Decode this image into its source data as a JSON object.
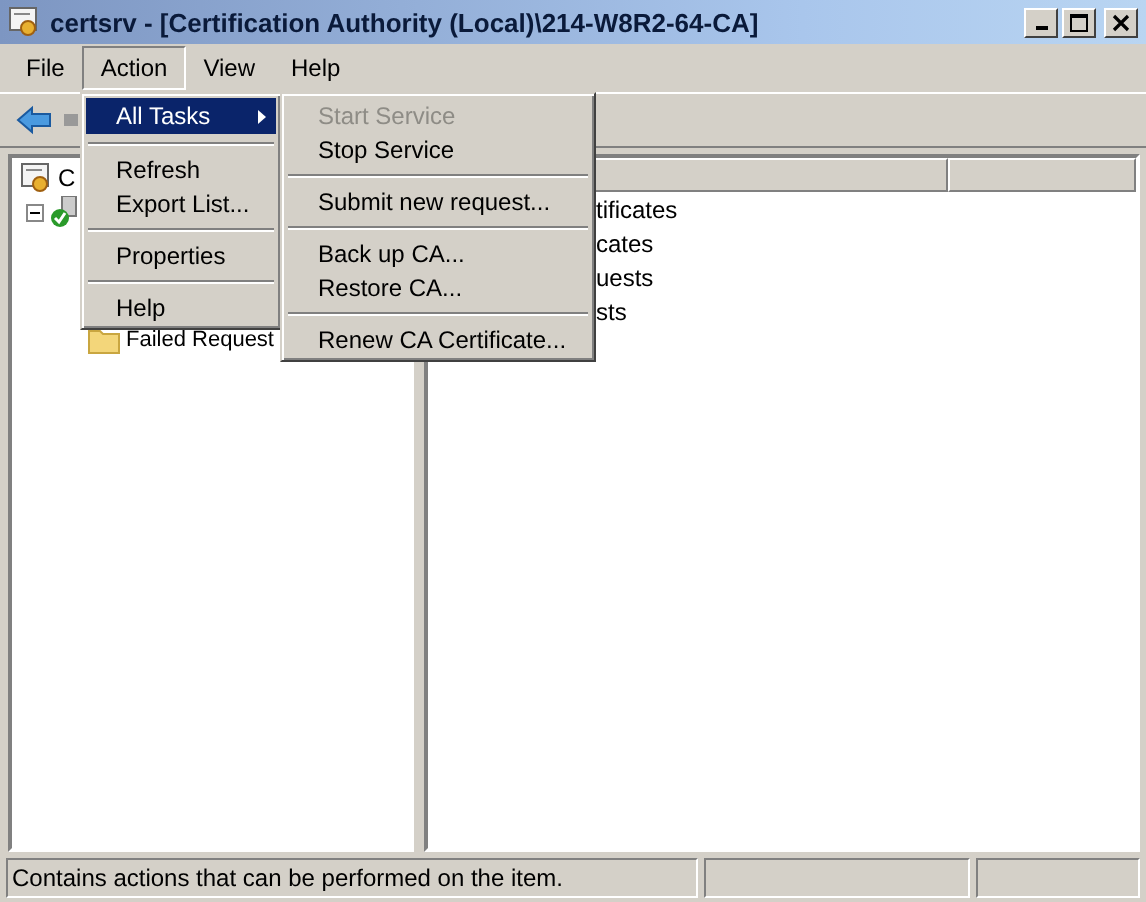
{
  "window": {
    "title": "certsrv - [Certification Authority (Local)\\214-W8R2-64-CA]"
  },
  "menu_bar": [
    {
      "label": "File",
      "selected": false
    },
    {
      "label": "Action",
      "selected": true
    },
    {
      "label": "View",
      "selected": false
    },
    {
      "label": "Help",
      "selected": false
    }
  ],
  "action_menu": [
    {
      "kind": "item",
      "label": "All Tasks",
      "selected": true,
      "has_submenu": true
    },
    {
      "kind": "separator"
    },
    {
      "kind": "item",
      "label": "Refresh",
      "selected": false,
      "has_submenu": false
    },
    {
      "kind": "item",
      "label": "Export List...",
      "selected": false,
      "has_submenu": false
    },
    {
      "kind": "separator"
    },
    {
      "kind": "item",
      "label": "Properties",
      "selected": false,
      "has_submenu": false
    },
    {
      "kind": "separator"
    },
    {
      "kind": "item",
      "label": "Help",
      "selected": false,
      "has_submenu": false
    }
  ],
  "all_tasks_menu": [
    {
      "kind": "item",
      "label": "Start Service",
      "disabled": true
    },
    {
      "kind": "item",
      "label": "Stop Service",
      "disabled": false
    },
    {
      "kind": "separator"
    },
    {
      "kind": "item",
      "label": "Submit new request...",
      "disabled": false
    },
    {
      "kind": "separator"
    },
    {
      "kind": "item",
      "label": "Back up CA...",
      "disabled": false
    },
    {
      "kind": "item",
      "label": "Restore CA...",
      "disabled": false
    },
    {
      "kind": "separator"
    },
    {
      "kind": "item",
      "label": "Renew CA Certificate...",
      "disabled": false
    }
  ],
  "tree": {
    "root_label": "C",
    "node": {
      "expanded": true,
      "children": [
        {
          "label": "Failed Request"
        }
      ]
    }
  },
  "list": {
    "items": [
      "tificates",
      "cates",
      "uests",
      "sts"
    ]
  },
  "status_bar": {
    "text": "Contains actions that can be performed on the item."
  }
}
